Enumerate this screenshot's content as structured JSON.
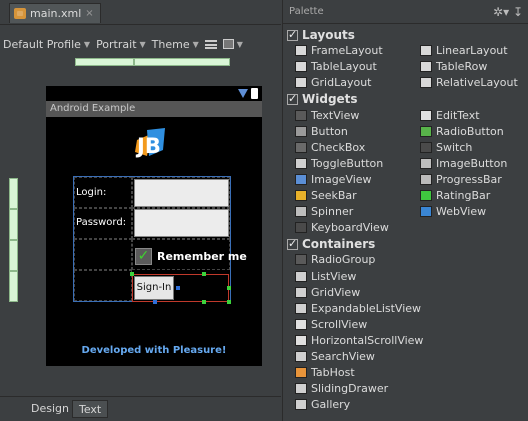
{
  "editor": {
    "file_tab": "main.xml",
    "close": "×",
    "toolbar": {
      "profile": "Default Profile",
      "orientation": "Portrait",
      "theme": "Theme"
    },
    "phone": {
      "app_title": "Android Example",
      "logo": "JB",
      "login_label": "Login:",
      "password_label": "Password:",
      "remember_label": "Remember me",
      "signin_label": "Sign-In",
      "footer": "Developed with Pleasure!"
    },
    "bottom_tabs": [
      "Design",
      "Text"
    ]
  },
  "palette": {
    "title": "Palette",
    "groups": [
      {
        "name": "Layouts",
        "items": [
          {
            "label": "FrameLayout",
            "icon": "frame-layout-icon",
            "color": "#d8d8d8"
          },
          {
            "label": "LinearLayout",
            "icon": "linear-layout-icon",
            "color": "#d8d8d8"
          },
          {
            "label": "TableLayout",
            "icon": "table-layout-icon",
            "color": "#d8d8d8"
          },
          {
            "label": "TableRow",
            "icon": "table-row-icon",
            "color": "#d8d8d8"
          },
          {
            "label": "GridLayout",
            "icon": "grid-layout-icon",
            "color": "#d8d8d8"
          },
          {
            "label": "RelativeLayout",
            "icon": "relative-layout-icon",
            "color": "#d8d8d8"
          }
        ]
      },
      {
        "name": "Widgets",
        "items": [
          {
            "label": "TextView",
            "icon": "text-view-icon",
            "color": "#5a5a5a"
          },
          {
            "label": "EditText",
            "icon": "edit-text-icon",
            "color": "#e0e0e0"
          },
          {
            "label": "Button",
            "icon": "button-icon",
            "color": "#9a9a9a"
          },
          {
            "label": "RadioButton",
            "icon": "radio-button-icon",
            "color": "#58b34a"
          },
          {
            "label": "CheckBox",
            "icon": "checkbox-icon",
            "color": "#6a6a6a"
          },
          {
            "label": "Switch",
            "icon": "switch-icon",
            "color": "#4a4a4a"
          },
          {
            "label": "ToggleButton",
            "icon": "toggle-button-icon",
            "color": "#d0d0d0"
          },
          {
            "label": "ImageButton",
            "icon": "image-button-icon",
            "color": "#bdbdbd"
          },
          {
            "label": "ImageView",
            "icon": "image-view-icon",
            "color": "#5b8fd6"
          },
          {
            "label": "ProgressBar",
            "icon": "progress-bar-icon",
            "color": "#bbbbbb"
          },
          {
            "label": "SeekBar",
            "icon": "seek-bar-icon",
            "color": "#e8b12a"
          },
          {
            "label": "RatingBar",
            "icon": "rating-bar-icon",
            "color": "#3fc83f"
          },
          {
            "label": "Spinner",
            "icon": "spinner-icon",
            "color": "#bdbdbd"
          },
          {
            "label": "WebView",
            "icon": "web-view-icon",
            "color": "#3a86d4"
          },
          {
            "label": "KeyboardView",
            "icon": "keyboard-view-icon",
            "color": "#4a4a4a"
          }
        ]
      },
      {
        "name": "Containers",
        "items": [
          {
            "label": "RadioGroup",
            "icon": "radio-group-icon",
            "color": "#5a5a5a"
          },
          {
            "label": "ListView",
            "icon": "list-view-icon",
            "color": "#d0d0d0"
          },
          {
            "label": "GridView",
            "icon": "grid-view-icon",
            "color": "#d0d0d0"
          },
          {
            "label": "ExpandableListView",
            "icon": "expandable-list-view-icon",
            "color": "#d0d0d0"
          },
          {
            "label": "ScrollView",
            "icon": "scroll-view-icon",
            "color": "#e0e0e0"
          },
          {
            "label": "HorizontalScrollView",
            "icon": "horizontal-scroll-view-icon",
            "color": "#e0e0e0"
          },
          {
            "label": "SearchView",
            "icon": "search-view-icon",
            "color": "#d0d0d0"
          },
          {
            "label": "TabHost",
            "icon": "tab-host-icon",
            "color": "#e8943a"
          },
          {
            "label": "SlidingDrawer",
            "icon": "sliding-drawer-icon",
            "color": "#d0d0d0"
          },
          {
            "label": "Gallery",
            "icon": "gallery-icon",
            "color": "#d0d0d0"
          }
        ]
      }
    ]
  }
}
